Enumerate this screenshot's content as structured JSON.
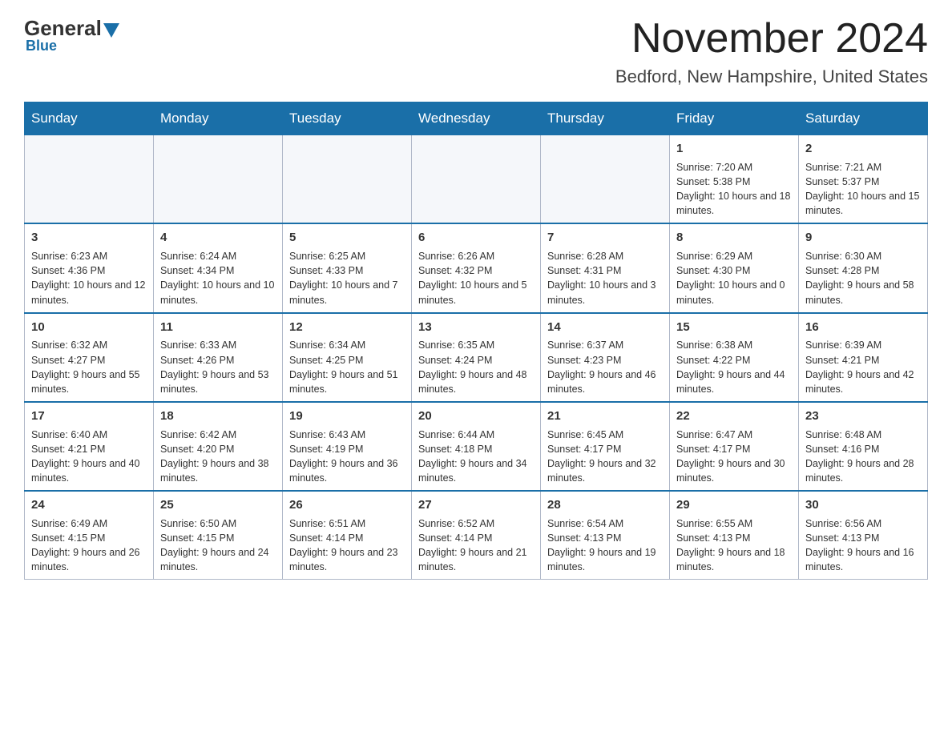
{
  "logo": {
    "general": "General",
    "blue": "Blue"
  },
  "title": "November 2024",
  "location": "Bedford, New Hampshire, United States",
  "days_of_week": [
    "Sunday",
    "Monday",
    "Tuesday",
    "Wednesday",
    "Thursday",
    "Friday",
    "Saturday"
  ],
  "weeks": [
    [
      {
        "day": "",
        "content": ""
      },
      {
        "day": "",
        "content": ""
      },
      {
        "day": "",
        "content": ""
      },
      {
        "day": "",
        "content": ""
      },
      {
        "day": "",
        "content": ""
      },
      {
        "day": "1",
        "content": "Sunrise: 7:20 AM\nSunset: 5:38 PM\nDaylight: 10 hours and 18 minutes."
      },
      {
        "day": "2",
        "content": "Sunrise: 7:21 AM\nSunset: 5:37 PM\nDaylight: 10 hours and 15 minutes."
      }
    ],
    [
      {
        "day": "3",
        "content": "Sunrise: 6:23 AM\nSunset: 4:36 PM\nDaylight: 10 hours and 12 minutes."
      },
      {
        "day": "4",
        "content": "Sunrise: 6:24 AM\nSunset: 4:34 PM\nDaylight: 10 hours and 10 minutes."
      },
      {
        "day": "5",
        "content": "Sunrise: 6:25 AM\nSunset: 4:33 PM\nDaylight: 10 hours and 7 minutes."
      },
      {
        "day": "6",
        "content": "Sunrise: 6:26 AM\nSunset: 4:32 PM\nDaylight: 10 hours and 5 minutes."
      },
      {
        "day": "7",
        "content": "Sunrise: 6:28 AM\nSunset: 4:31 PM\nDaylight: 10 hours and 3 minutes."
      },
      {
        "day": "8",
        "content": "Sunrise: 6:29 AM\nSunset: 4:30 PM\nDaylight: 10 hours and 0 minutes."
      },
      {
        "day": "9",
        "content": "Sunrise: 6:30 AM\nSunset: 4:28 PM\nDaylight: 9 hours and 58 minutes."
      }
    ],
    [
      {
        "day": "10",
        "content": "Sunrise: 6:32 AM\nSunset: 4:27 PM\nDaylight: 9 hours and 55 minutes."
      },
      {
        "day": "11",
        "content": "Sunrise: 6:33 AM\nSunset: 4:26 PM\nDaylight: 9 hours and 53 minutes."
      },
      {
        "day": "12",
        "content": "Sunrise: 6:34 AM\nSunset: 4:25 PM\nDaylight: 9 hours and 51 minutes."
      },
      {
        "day": "13",
        "content": "Sunrise: 6:35 AM\nSunset: 4:24 PM\nDaylight: 9 hours and 48 minutes."
      },
      {
        "day": "14",
        "content": "Sunrise: 6:37 AM\nSunset: 4:23 PM\nDaylight: 9 hours and 46 minutes."
      },
      {
        "day": "15",
        "content": "Sunrise: 6:38 AM\nSunset: 4:22 PM\nDaylight: 9 hours and 44 minutes."
      },
      {
        "day": "16",
        "content": "Sunrise: 6:39 AM\nSunset: 4:21 PM\nDaylight: 9 hours and 42 minutes."
      }
    ],
    [
      {
        "day": "17",
        "content": "Sunrise: 6:40 AM\nSunset: 4:21 PM\nDaylight: 9 hours and 40 minutes."
      },
      {
        "day": "18",
        "content": "Sunrise: 6:42 AM\nSunset: 4:20 PM\nDaylight: 9 hours and 38 minutes."
      },
      {
        "day": "19",
        "content": "Sunrise: 6:43 AM\nSunset: 4:19 PM\nDaylight: 9 hours and 36 minutes."
      },
      {
        "day": "20",
        "content": "Sunrise: 6:44 AM\nSunset: 4:18 PM\nDaylight: 9 hours and 34 minutes."
      },
      {
        "day": "21",
        "content": "Sunrise: 6:45 AM\nSunset: 4:17 PM\nDaylight: 9 hours and 32 minutes."
      },
      {
        "day": "22",
        "content": "Sunrise: 6:47 AM\nSunset: 4:17 PM\nDaylight: 9 hours and 30 minutes."
      },
      {
        "day": "23",
        "content": "Sunrise: 6:48 AM\nSunset: 4:16 PM\nDaylight: 9 hours and 28 minutes."
      }
    ],
    [
      {
        "day": "24",
        "content": "Sunrise: 6:49 AM\nSunset: 4:15 PM\nDaylight: 9 hours and 26 minutes."
      },
      {
        "day": "25",
        "content": "Sunrise: 6:50 AM\nSunset: 4:15 PM\nDaylight: 9 hours and 24 minutes."
      },
      {
        "day": "26",
        "content": "Sunrise: 6:51 AM\nSunset: 4:14 PM\nDaylight: 9 hours and 23 minutes."
      },
      {
        "day": "27",
        "content": "Sunrise: 6:52 AM\nSunset: 4:14 PM\nDaylight: 9 hours and 21 minutes."
      },
      {
        "day": "28",
        "content": "Sunrise: 6:54 AM\nSunset: 4:13 PM\nDaylight: 9 hours and 19 minutes."
      },
      {
        "day": "29",
        "content": "Sunrise: 6:55 AM\nSunset: 4:13 PM\nDaylight: 9 hours and 18 minutes."
      },
      {
        "day": "30",
        "content": "Sunrise: 6:56 AM\nSunset: 4:13 PM\nDaylight: 9 hours and 16 minutes."
      }
    ]
  ]
}
